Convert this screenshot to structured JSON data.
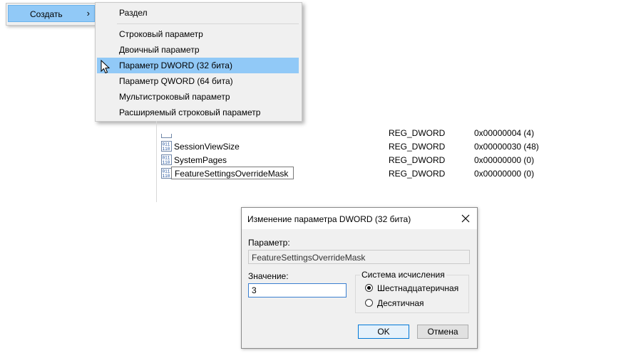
{
  "context_menu": {
    "parent_item": "Создать",
    "arrow": "›"
  },
  "submenu": {
    "items": [
      "Раздел",
      "Строковый параметр",
      "Двоичный параметр",
      "Параметр DWORD (32 бита)",
      "Параметр QWORD (64 бита)",
      "Мультистроковый параметр",
      "Расширяемый строковый параметр"
    ],
    "highlighted": "Параметр DWORD (32 бита)"
  },
  "registry_values": [
    {
      "name": "",
      "type": "REG_DWORD",
      "data": "0x00000004 (4)"
    },
    {
      "name": "SessionViewSize",
      "type": "REG_DWORD",
      "data": "0x00000030 (48)"
    },
    {
      "name": "SystemPages",
      "type": "REG_DWORD",
      "data": "0x00000000 (0)"
    },
    {
      "name": "FeatureSettingsOverrideMask",
      "type": "REG_DWORD",
      "data": "0x00000000 (0)"
    }
  ],
  "dialog": {
    "title": "Изменение параметра DWORD (32 бита)",
    "param_label": "Параметр:",
    "param_value": "FeatureSettingsOverrideMask",
    "value_label": "Значение:",
    "value": "3",
    "base_group_label": "Система исчисления",
    "radio_hex": "Шестнадцатеричная",
    "radio_dec": "Десятичная",
    "selected_base": "hex",
    "ok": "OK",
    "cancel": "Отмена"
  },
  "colors": {
    "menu_highlight": "#91c9f7",
    "menu_bg": "#f0f0f0",
    "dialog_bg": "#f0f0f0",
    "default_button_border": "#0078d7"
  },
  "icons": [
    "submenu-arrow-icon",
    "mouse-cursor-icon",
    "reg-dword-icon",
    "close-icon"
  ]
}
